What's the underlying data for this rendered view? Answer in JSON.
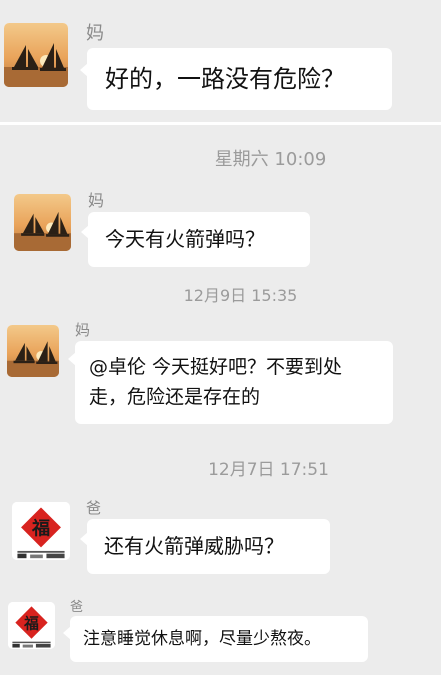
{
  "screens": [
    {
      "messages": [
        {
          "sender": "妈",
          "text": "好的，一路没有危险？"
        }
      ]
    },
    {
      "items": [
        {
          "kind": "timestamp",
          "text": "星期六 10:09"
        },
        {
          "kind": "message",
          "sender": "妈",
          "text": "今天有火箭弹吗？"
        },
        {
          "kind": "timestamp",
          "text": "12月9日 15:35"
        },
        {
          "kind": "message",
          "sender": "妈",
          "text": "@卓伦 今天挺好吧？不要到处\n走，危险还是存在的"
        },
        {
          "kind": "timestamp",
          "text": "12月7日 17:51"
        },
        {
          "kind": "message",
          "sender": "爸",
          "text": "还有火箭弹威胁吗？"
        },
        {
          "kind": "message",
          "sender": "爸",
          "text": "注意睡觉休息啊，尽量少熬夜。"
        }
      ]
    }
  ],
  "avatars": {
    "mom": {
      "icon": "sunset-sailboat-avatar-icon"
    },
    "dad": {
      "icon": "fortune-couplet-avatar-icon",
      "glyph": "福"
    }
  },
  "colors": {
    "background": "#ececec",
    "bubble": "#ffffff",
    "timestamp_text": "#9b9b9b",
    "sender_text": "#8a8a8a"
  }
}
